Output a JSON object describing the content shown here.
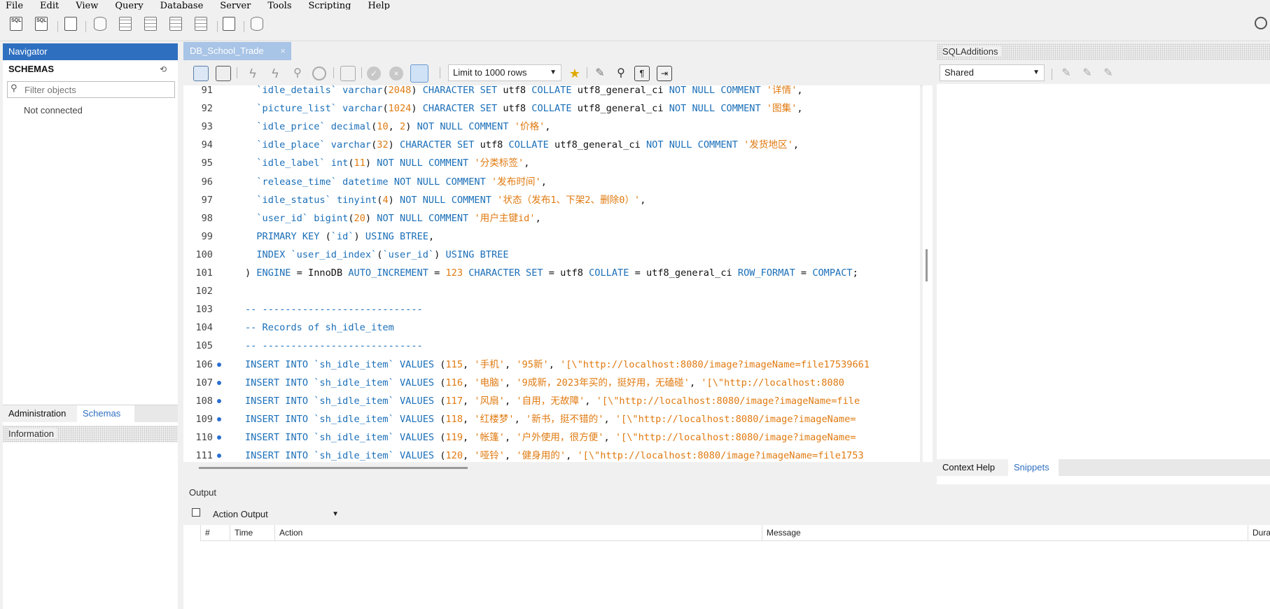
{
  "menu": [
    "File",
    "Edit",
    "View",
    "Query",
    "Database",
    "Server",
    "Tools",
    "Scripting",
    "Help"
  ],
  "navigator": {
    "title": "Navigator",
    "schemas_label": "SCHEMAS",
    "filter_placeholder": "Filter objects",
    "status": "Not connected",
    "tabs": [
      "Administration",
      "Schemas"
    ],
    "info_title": "Information"
  },
  "editor": {
    "tab_title": "DB_School_Trade",
    "limit": "Limit to 1000 rows",
    "lines": [
      {
        "n": "91",
        "dot": false,
        "h": "  <span class='cm'>`idle_details`</span> <span class='kw'>varchar</span>(<span class='nm'>2048</span>) <span class='kw'>CHARACTER SET</span> utf8 <span class='kw'>COLLATE</span> utf8_general_ci <span class='kw'>NOT NULL</span> <span class='kw'>COMMENT</span> <span class='st'>'详情'</span>,"
      },
      {
        "n": "92",
        "dot": false,
        "h": "  <span class='cm'>`picture_list`</span> <span class='kw'>varchar</span>(<span class='nm'>1024</span>) <span class='kw'>CHARACTER SET</span> utf8 <span class='kw'>COLLATE</span> utf8_general_ci <span class='kw'>NOT NULL</span> <span class='kw'>COMMENT</span> <span class='st'>'图集'</span>,"
      },
      {
        "n": "93",
        "dot": false,
        "h": "  <span class='cm'>`idle_price`</span> <span class='kw'>decimal</span>(<span class='nm'>10</span>, <span class='nm'>2</span>) <span class='kw'>NOT NULL</span> <span class='kw'>COMMENT</span> <span class='st'>'价格'</span>,"
      },
      {
        "n": "94",
        "dot": false,
        "h": "  <span class='cm'>`idle_place`</span> <span class='kw'>varchar</span>(<span class='nm'>32</span>) <span class='kw'>CHARACTER SET</span> utf8 <span class='kw'>COLLATE</span> utf8_general_ci <span class='kw'>NOT NULL</span> <span class='kw'>COMMENT</span> <span class='st'>'发货地区'</span>,"
      },
      {
        "n": "95",
        "dot": false,
        "h": "  <span class='cm'>`idle_label`</span> <span class='kw'>int</span>(<span class='nm'>11</span>) <span class='kw'>NOT NULL</span> <span class='kw'>COMMENT</span> <span class='st'>'分类标签'</span>,"
      },
      {
        "n": "96",
        "dot": false,
        "h": "  <span class='cm'>`release_time`</span> <span class='kw'>datetime</span> <span class='kw'>NOT NULL</span> <span class='kw'>COMMENT</span> <span class='st'>'发布时间'</span>,"
      },
      {
        "n": "97",
        "dot": false,
        "h": "  <span class='cm'>`idle_status`</span> <span class='kw'>tinyint</span>(<span class='nm'>4</span>) <span class='kw'>NOT NULL</span> <span class='kw'>COMMENT</span> <span class='st'>'状态（发布1、下架2、删除0）'</span>,"
      },
      {
        "n": "98",
        "dot": false,
        "h": "  <span class='cm'>`user_id`</span> <span class='kw'>bigint</span>(<span class='nm'>20</span>) <span class='kw'>NOT NULL</span> <span class='kw'>COMMENT</span> <span class='st'>'用户主键id'</span>,"
      },
      {
        "n": "99",
        "dot": false,
        "h": "  <span class='kw'>PRIMARY KEY</span> (<span class='cm'>`id`</span>) <span class='kw'>USING</span> <span class='kw'>BTREE</span>,"
      },
      {
        "n": "100",
        "dot": false,
        "h": "  <span class='kw'>INDEX</span> <span class='cm'>`user_id_index`</span>(<span class='cm'>`user_id`</span>) <span class='kw'>USING</span> <span class='kw'>BTREE</span>"
      },
      {
        "n": "101",
        "dot": false,
        "h": ") <span class='kw'>ENGINE</span> = InnoDB <span class='kw'>AUTO_INCREMENT</span> = <span class='nm'>123</span> <span class='kw'>CHARACTER SET</span> = utf8 <span class='kw'>COLLATE</span> = utf8_general_ci <span class='kw'>ROW_FORMAT</span> = <span class='kw'>COMPACT</span>;"
      },
      {
        "n": "102",
        "dot": false,
        "h": ""
      },
      {
        "n": "103",
        "dot": false,
        "h": "<span class='cm'>-- ----------------------------</span>"
      },
      {
        "n": "104",
        "dot": false,
        "h": "<span class='cm'>-- Records of sh_idle_item</span>"
      },
      {
        "n": "105",
        "dot": false,
        "h": "<span class='cm'>-- ----------------------------</span>"
      },
      {
        "n": "106",
        "dot": true,
        "h": "<span class='kw'>INSERT INTO</span> <span class='cm'>`sh_idle_item`</span> <span class='kw'>VALUES</span> (<span class='nm'>115</span>, <span class='st'>'手机'</span>, <span class='st'>'95新'</span>, <span class='st'>'[\\\"http://localhost:8080/image?imageName=file17539661</span>"
      },
      {
        "n": "107",
        "dot": true,
        "h": "<span class='kw'>INSERT INTO</span> <span class='cm'>`sh_idle_item`</span> <span class='kw'>VALUES</span> (<span class='nm'>116</span>, <span class='st'>'电脑'</span>, <span class='st'>'9成新，2023年买的，挺好用，无磕碰'</span>, <span class='st'>'[\\\"http://localhost:8080</span>"
      },
      {
        "n": "108",
        "dot": true,
        "h": "<span class='kw'>INSERT INTO</span> <span class='cm'>`sh_idle_item`</span> <span class='kw'>VALUES</span> (<span class='nm'>117</span>, <span class='st'>'风扇'</span>, <span class='st'>'自用，无故障'</span>, <span class='st'>'[\\\"http://localhost:8080/image?imageName=file</span>"
      },
      {
        "n": "109",
        "dot": true,
        "h": "<span class='kw'>INSERT INTO</span> <span class='cm'>`sh_idle_item`</span> <span class='kw'>VALUES</span> (<span class='nm'>118</span>, <span class='st'>'红楼梦'</span>, <span class='st'>'新书，挺不错的'</span>, <span class='st'>'[\\\"http://localhost:8080/image?imageName=</span>"
      },
      {
        "n": "110",
        "dot": true,
        "h": "<span class='kw'>INSERT INTO</span> <span class='cm'>`sh_idle_item`</span> <span class='kw'>VALUES</span> (<span class='nm'>119</span>, <span class='st'>'帐篷'</span>, <span class='st'>'户外使用，很方便'</span>, <span class='st'>'[\\\"http://localhost:8080/image?imageName=</span>"
      },
      {
        "n": "111",
        "dot": true,
        "h": "<span class='kw'>INSERT INTO</span> <span class='cm'>`sh_idle_item`</span> <span class='kw'>VALUES</span> (<span class='nm'>120</span>, <span class='st'>'哑铃'</span>, <span class='st'>'健身用的'</span>, <span class='st'>'[\\\"http://localhost:8080/image?imageName=file1753</span>"
      }
    ]
  },
  "sql_additions": {
    "title": "SQLAdditions",
    "shared": "Shared",
    "tabs": [
      "Context Help",
      "Snippets"
    ]
  },
  "output": {
    "title": "Output",
    "select": "Action Output",
    "columns": [
      "#",
      "Time",
      "Action",
      "Message",
      "Dura"
    ]
  },
  "colors": {
    "accent": "#2f6fc0",
    "tab_inactive": "#a8c4e6",
    "keyword": "#1b6fb8",
    "string": "#e07a10"
  }
}
